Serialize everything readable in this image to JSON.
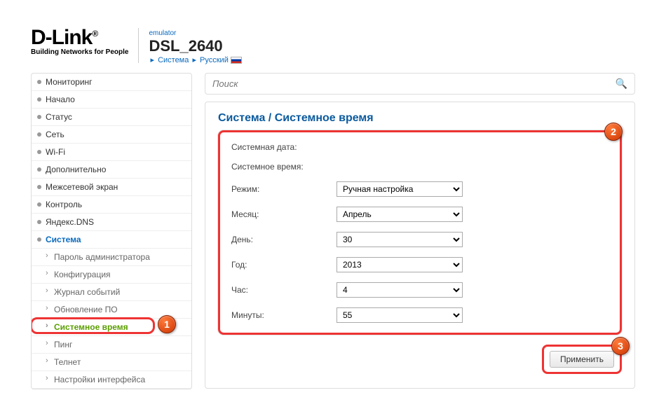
{
  "header": {
    "logo_tagline": "Building Networks for People",
    "emulator_label": "emulator",
    "model": "DSL_2640",
    "breadcrumb": {
      "item1": "Система",
      "item2": "Русский"
    }
  },
  "sidebar": {
    "top": [
      "Мониторинг",
      "Начало",
      "Статус",
      "Сеть",
      "Wi-Fi",
      "Дополнительно",
      "Межсетевой экран",
      "Контроль",
      "Яндекс.DNS",
      "Система"
    ],
    "sub": [
      "Пароль администратора",
      "Конфигурация",
      "Журнал событий",
      "Обновление ПО",
      "Системное время",
      "Пинг",
      "Телнет",
      "Настройки интерфейса"
    ],
    "active_sub_index": 4
  },
  "search": {
    "placeholder": "Поиск"
  },
  "content": {
    "title_parent": "Система",
    "title_current": "Системное время",
    "labels": {
      "sys_date": "Системная дата:",
      "sys_time": "Системное время:",
      "mode": "Режим:",
      "month": "Месяц:",
      "day": "День:",
      "year": "Год:",
      "hour": "Час:",
      "minute": "Минуты:"
    },
    "values": {
      "mode": "Ручная настройка",
      "month": "Апрель",
      "day": "30",
      "year": "2013",
      "hour": "4",
      "minute": "55"
    },
    "apply_label": "Применить"
  },
  "badges": {
    "b1": "1",
    "b2": "2",
    "b3": "3"
  }
}
